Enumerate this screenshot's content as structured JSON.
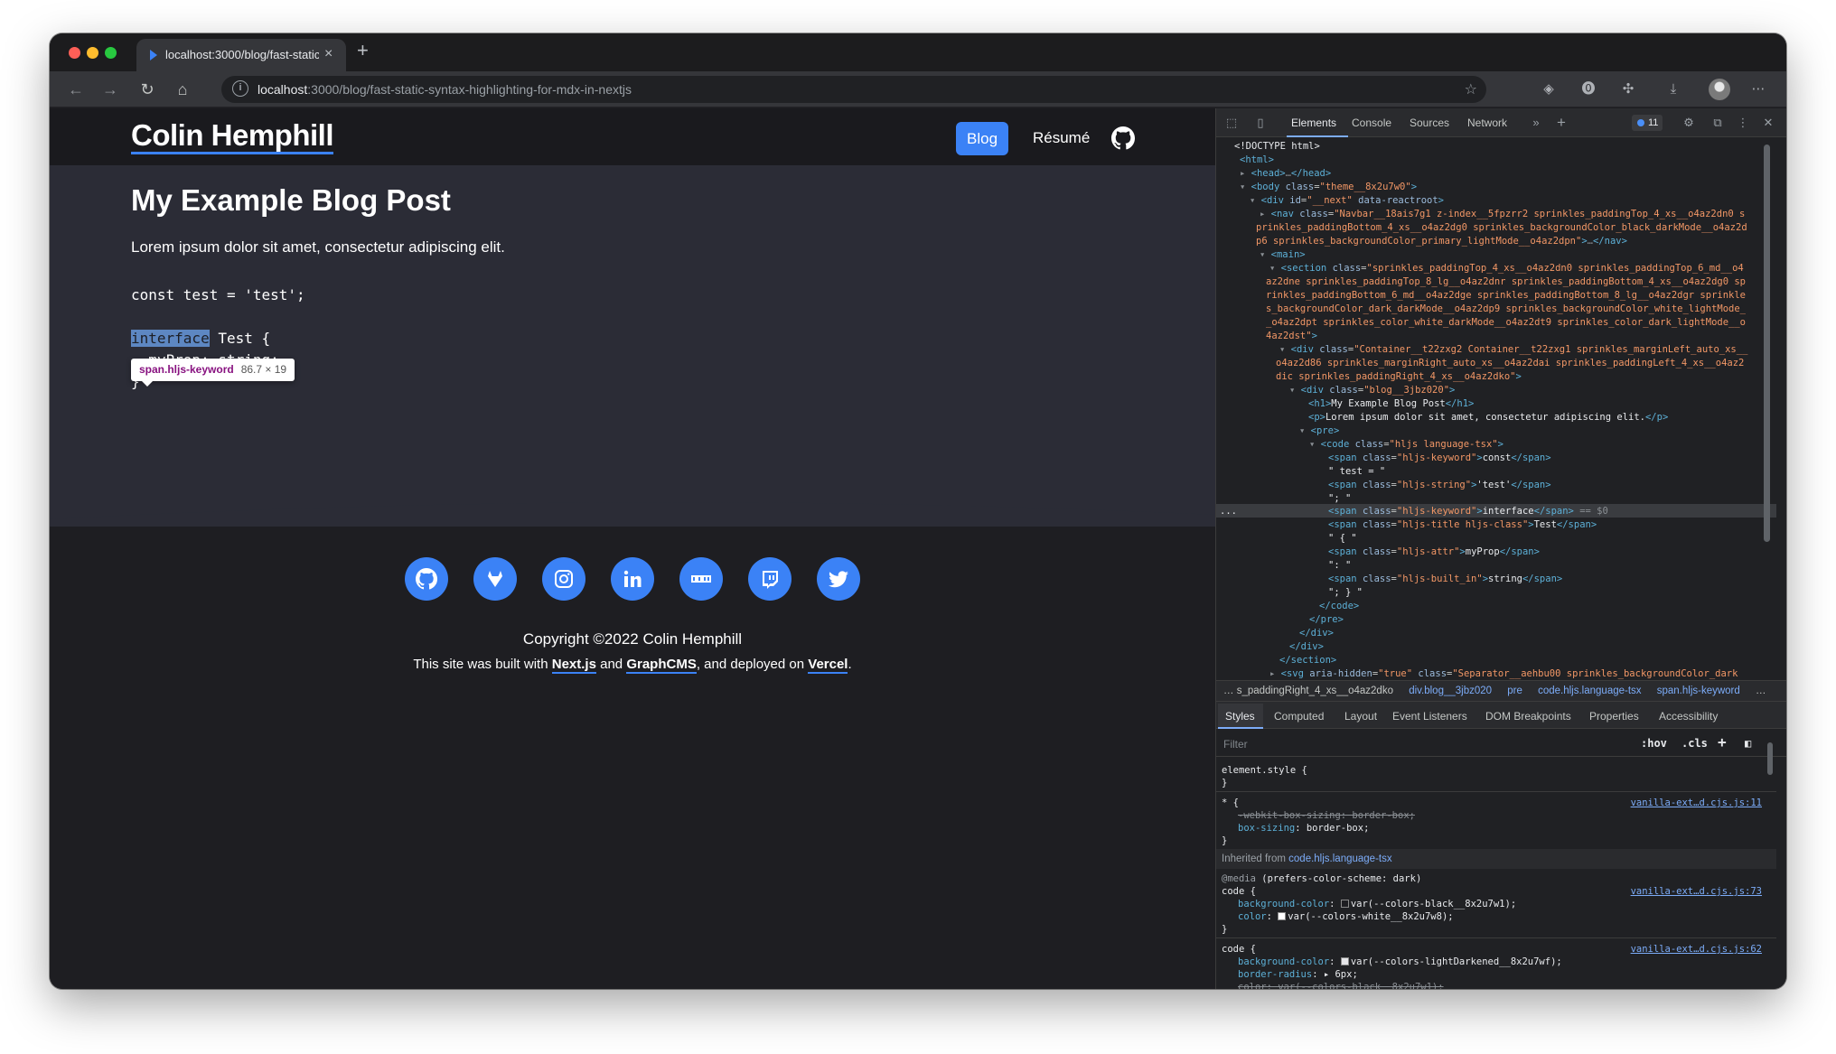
{
  "browser": {
    "tab_title": "localhost:3000/blog/fast-static-",
    "url_host": "localhost",
    "url_path": ":3000/blog/fast-static-syntax-highlighting-for-mdx-in-nextjs"
  },
  "site": {
    "brand": "Colin Hemphill",
    "nav": {
      "blog": "Blog",
      "resume": "Résumé"
    },
    "post_title": "My Example Blog Post",
    "post_text": "Lorem ipsum dolor sit amet, consectetur adipiscing elit.",
    "code_lines": [
      "const test = 'test';",
      "interface",
      " Test {",
      "  myProp: string;",
      "}"
    ],
    "tooltip": {
      "selector": "span.hljs-keyword",
      "dims": "86.7 × 19"
    },
    "socials": [
      "github-icon",
      "gitlab-icon",
      "instagram-icon",
      "linkedin-icon",
      "npm-icon",
      "twitch-icon",
      "twitter-icon"
    ],
    "accent": "#3b82f6",
    "copyright": "Copyright ©2022 Colin Hemphill",
    "built": {
      "pre": "This site was built with ",
      "next": "Next.js",
      "and": " and ",
      "cms": "GraphCMS",
      "mid": ", and deployed on ",
      "vercel": "Vercel",
      "end": "."
    }
  },
  "devtools": {
    "tabs": [
      "Elements",
      "Console",
      "Sources",
      "Network"
    ],
    "issues_count": "11",
    "breadcrumbs": [
      "… ",
      "s_paddingRight_4_xs__o4az2dko",
      "div.blog__3jbz020",
      "pre",
      "code.hljs.language-tsx",
      "span.hljs-keyword",
      "…"
    ],
    "subtabs": [
      "Styles",
      "Computed",
      "Layout",
      "Event Listeners",
      "DOM Breakpoints",
      "Properties",
      "Accessibility"
    ],
    "filter_placeholder": "Filter",
    "filter_hov": ":hov",
    "filter_cls": ".cls",
    "inherited_label": "Inherited from ",
    "inherited_from": "code.hljs.language-tsx",
    "links": [
      "vanilla-ext…d.cjs.js:11",
      "vanilla-ext…d.cjs.js:73",
      "vanilla-ext…d.cjs.js:62"
    ]
  }
}
